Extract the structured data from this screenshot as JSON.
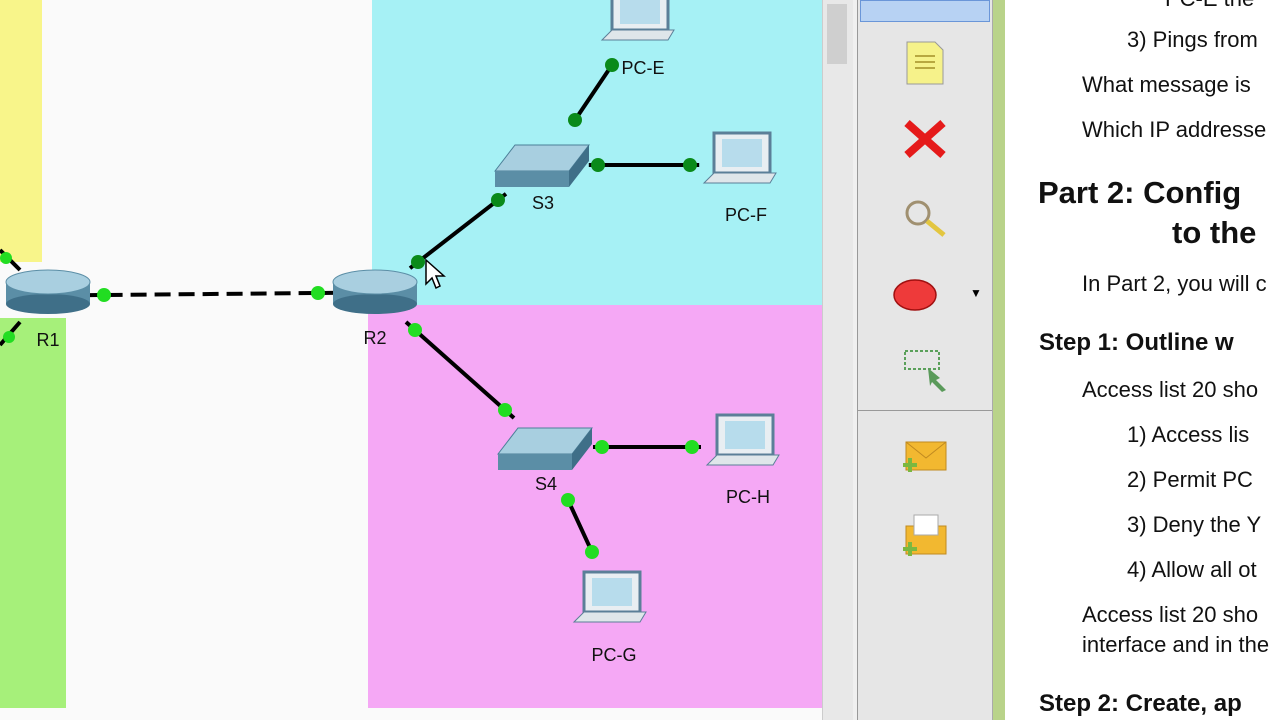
{
  "topology": {
    "devices": [
      {
        "id": "R1",
        "label": "R1",
        "type": "router"
      },
      {
        "id": "R2",
        "label": "R2",
        "type": "router"
      },
      {
        "id": "S3",
        "label": "S3",
        "type": "switch"
      },
      {
        "id": "S4",
        "label": "S4",
        "type": "switch"
      },
      {
        "id": "PC-E",
        "label": "PC-E",
        "type": "pc"
      },
      {
        "id": "PC-F",
        "label": "PC-F",
        "type": "pc"
      },
      {
        "id": "PC-H",
        "label": "PC-H",
        "type": "pc"
      },
      {
        "id": "PC-G",
        "label": "PC-G",
        "type": "pc"
      }
    ],
    "links": [
      [
        "R1",
        "R2",
        "serial"
      ],
      [
        "R2",
        "S3",
        "ethernet"
      ],
      [
        "S3",
        "PC-E",
        "ethernet"
      ],
      [
        "S3",
        "PC-F",
        "ethernet"
      ],
      [
        "R2",
        "S4",
        "ethernet"
      ],
      [
        "S4",
        "PC-H",
        "ethernet"
      ],
      [
        "S4",
        "PC-G",
        "ethernet"
      ]
    ],
    "colors": {
      "zone_cyan": "#a6f1f5",
      "zone_pink": "#f5a8f5",
      "zone_yellow": "#f8f58a",
      "zone_green": "#a6f07a",
      "link_up": "#22dd22"
    }
  },
  "toolbar": {
    "tools": [
      "select-icon",
      "note-icon",
      "delete-icon",
      "inspect-icon",
      "draw-ellipse-icon",
      "resize-icon",
      "add-simple-pdu-icon",
      "add-complex-pdu-icon"
    ]
  },
  "document": {
    "line0": "PC-E the",
    "item3a": "3)  Pings from",
    "q1": "What message is",
    "q2": "Which IP addresse",
    "part2_line1": "Part 2:   Config",
    "part2_line2": "to the",
    "part2_intro": "In Part 2, you will c",
    "step1": "Step 1:   Outline w",
    "al_intro": "Access list 20 sho",
    "items": [
      "1)  Access lis",
      "2)  Permit PC",
      "3)  Deny the Y",
      "4)  Allow all ot"
    ],
    "al_outro1": "Access list 20 sho",
    "al_outro2": "interface and in the",
    "step2": "Step 2:   Create, ap"
  }
}
